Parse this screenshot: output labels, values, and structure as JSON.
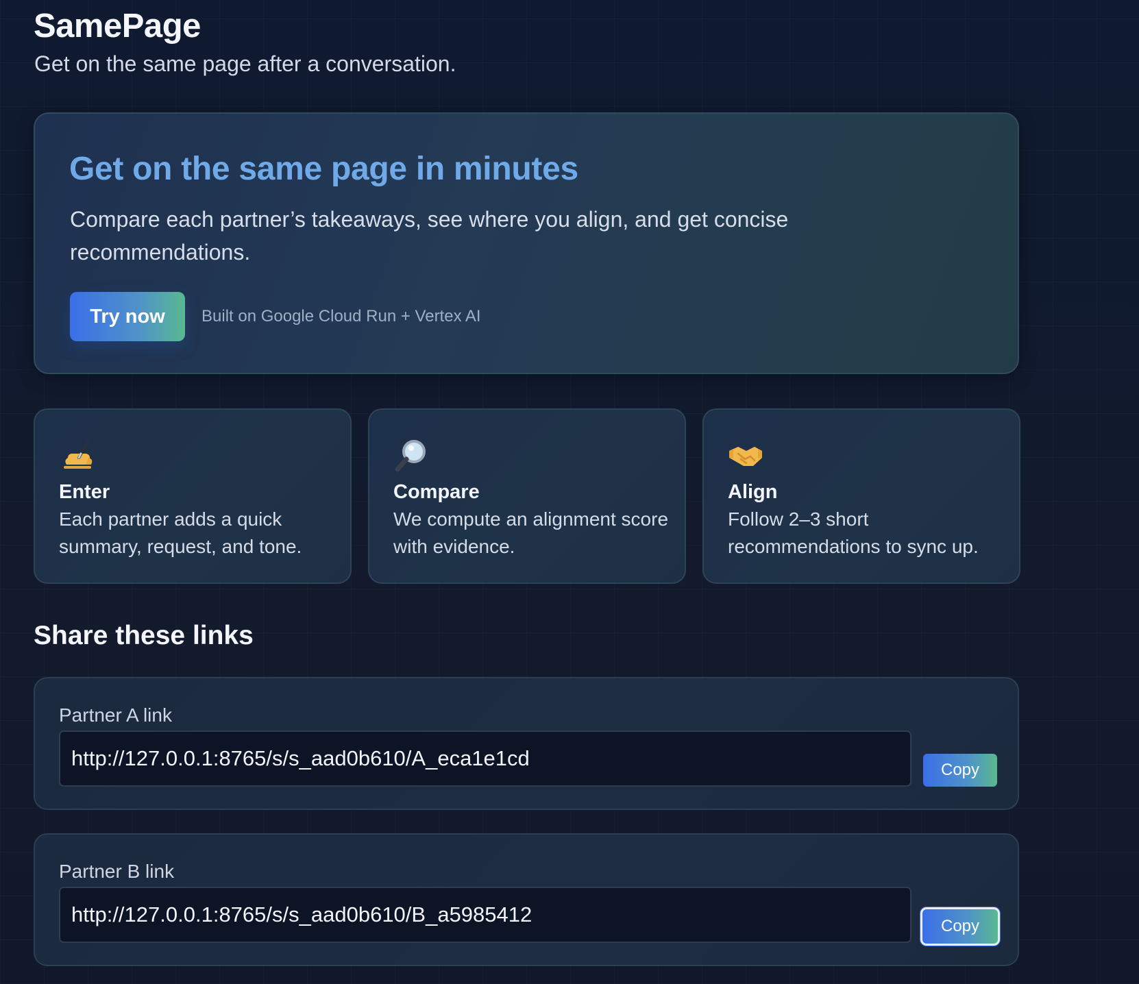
{
  "header": {
    "title": "SamePage",
    "subtitle": "Get on the same page after a conversation."
  },
  "hero": {
    "title": "Get on the same page in minutes",
    "description": "Compare each partner’s takeaways, see where you align, and get concise recommendations.",
    "cta_label": "Try now",
    "built_on": "Built on Google Cloud Run + Vertex AI"
  },
  "features": [
    {
      "icon": "writing-hand-icon",
      "title": "Enter",
      "text": "Each partner adds a quick summary, request, and tone."
    },
    {
      "icon": "magnifying-glass-icon",
      "title": "Compare",
      "text": "We compute an alignment score with evidence."
    },
    {
      "icon": "handshake-icon",
      "title": "Align",
      "text": "Follow 2–3 short recommendations to sync up."
    }
  ],
  "share": {
    "title": "Share these links",
    "links": [
      {
        "label": "Partner A link",
        "value": "http://127.0.0.1:8765/s/s_aad0b610/A_eca1e1cd",
        "copy_label": "Copy"
      },
      {
        "label": "Partner B link",
        "value": "http://127.0.0.1:8765/s/s_aad0b610/B_a5985412",
        "copy_label": "Copy"
      }
    ]
  },
  "colors": {
    "background": "#111a2e",
    "accent_title": "#6fa9e8",
    "button_gradient_start": "#3b6ee8",
    "button_gradient_end": "#59b98f"
  }
}
